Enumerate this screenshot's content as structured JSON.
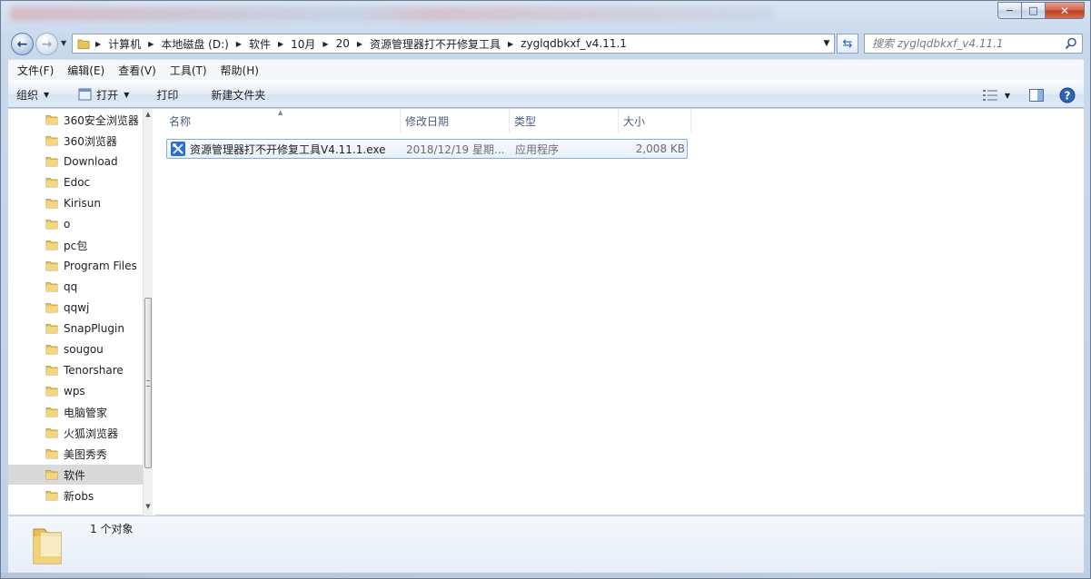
{
  "window": {
    "caption_buttons": {
      "minimize": "−",
      "maximize": "□",
      "close": "✕"
    }
  },
  "address_bar": {
    "crumbs": [
      "计算机",
      "本地磁盘 (D:)",
      "软件",
      "10月",
      "20",
      "资源管理器打不开修复工具",
      "zyglqdbkxf_v4.11.1"
    ]
  },
  "search": {
    "placeholder": "搜索 zyglqdbkxf_v4.11.1"
  },
  "menubar": [
    "文件(F)",
    "编辑(E)",
    "查看(V)",
    "工具(T)",
    "帮助(H)"
  ],
  "toolbar": {
    "organize": "组织",
    "open": "打开",
    "print": "打印",
    "new_folder": "新建文件夹"
  },
  "nav_tree": [
    "360安全浏览器",
    "360浏览器",
    "Download",
    "Edoc",
    "Kirisun",
    "o",
    "pc包",
    "Program Files",
    "qq",
    "qqwj",
    "SnapPlugin",
    "sougou",
    "Tenorshare",
    "wps",
    "电脑管家",
    "火狐浏览器",
    "美图秀秀",
    "软件",
    "新obs"
  ],
  "nav_selected": "软件",
  "columns": {
    "name": "名称",
    "modified": "修改日期",
    "type": "类型",
    "size": "大小"
  },
  "files": [
    {
      "name": "资源管理器打不开修复工具V4.11.1.exe",
      "modified": "2018/12/19 星期...",
      "type": "应用程序",
      "size": "2,008 KB"
    }
  ],
  "status": {
    "count_text": "1 个对象"
  },
  "colors": {
    "folder": "#e8c45a",
    "selection_border": "#84acdd",
    "accent": "#2a62b4"
  }
}
